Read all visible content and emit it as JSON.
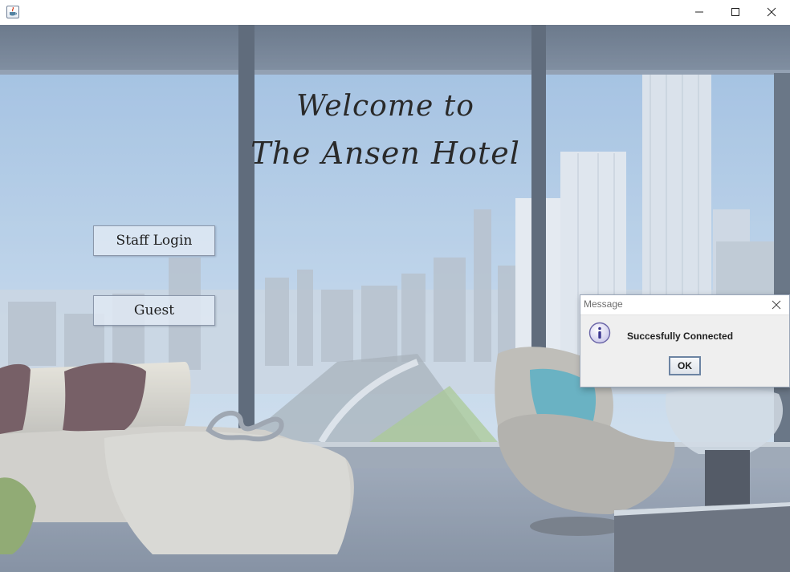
{
  "window": {
    "icon": "java-coffee-cup-icon",
    "minimize_icon": "minimize-icon",
    "maximize_icon": "maximize-icon",
    "close_icon": "close-icon"
  },
  "heading": {
    "line1": "Welcome to",
    "line2": "The Ansen Hotel"
  },
  "buttons": {
    "staff_login": "Staff Login",
    "guest": "Guest"
  },
  "dialog": {
    "title": "Message",
    "message": "Succesfully Connected",
    "ok_label": "OK",
    "icon": "info-icon"
  },
  "colors": {
    "sky": "#aac6e4",
    "frame": "#3c4a5c",
    "accent_border": "#6c84a3"
  }
}
